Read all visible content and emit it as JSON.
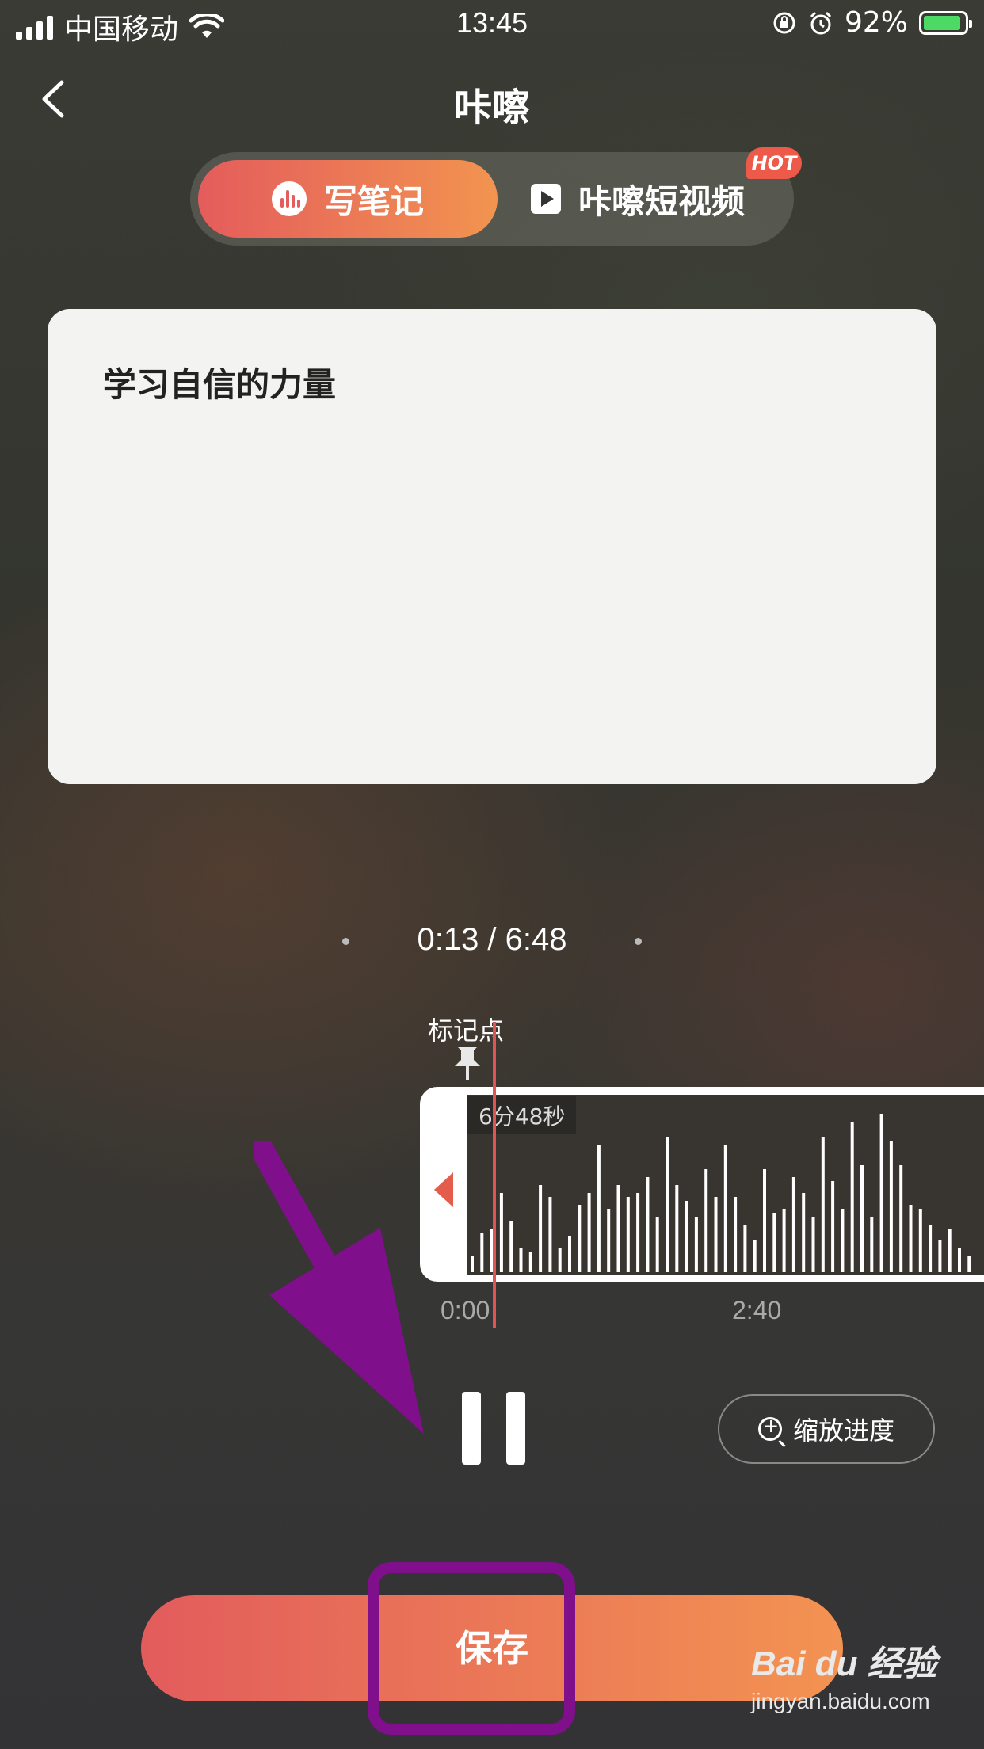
{
  "status_bar": {
    "carrier": "中国移动",
    "time": "13:45",
    "battery": "92%"
  },
  "header": {
    "title": "咔嚓",
    "back_icon": "chevron-left-icon"
  },
  "tabs": [
    {
      "label": "写笔记",
      "icon": "audio-wave-icon",
      "active": true
    },
    {
      "label": "咔嚓短视频",
      "icon": "play-icon",
      "active": false,
      "badge": "HOT"
    }
  ],
  "note": {
    "text": "学习自信的力量"
  },
  "player": {
    "time_display": "0:13 / 6:48",
    "mark_label": "标记点",
    "duration_badge": "6分48秒",
    "ticks": [
      "0:00",
      "2:40"
    ],
    "zoom_label": "缩放进度",
    "state": "playing"
  },
  "actions": {
    "save_label": "保存"
  },
  "watermark": {
    "brand": "Bai du 经验",
    "url": "jingyan.baidu.com"
  },
  "colors": {
    "accent_start": "#e45c5c",
    "accent_end": "#f29450",
    "annotation": "#7f0f8a",
    "playhead": "#e25454"
  }
}
